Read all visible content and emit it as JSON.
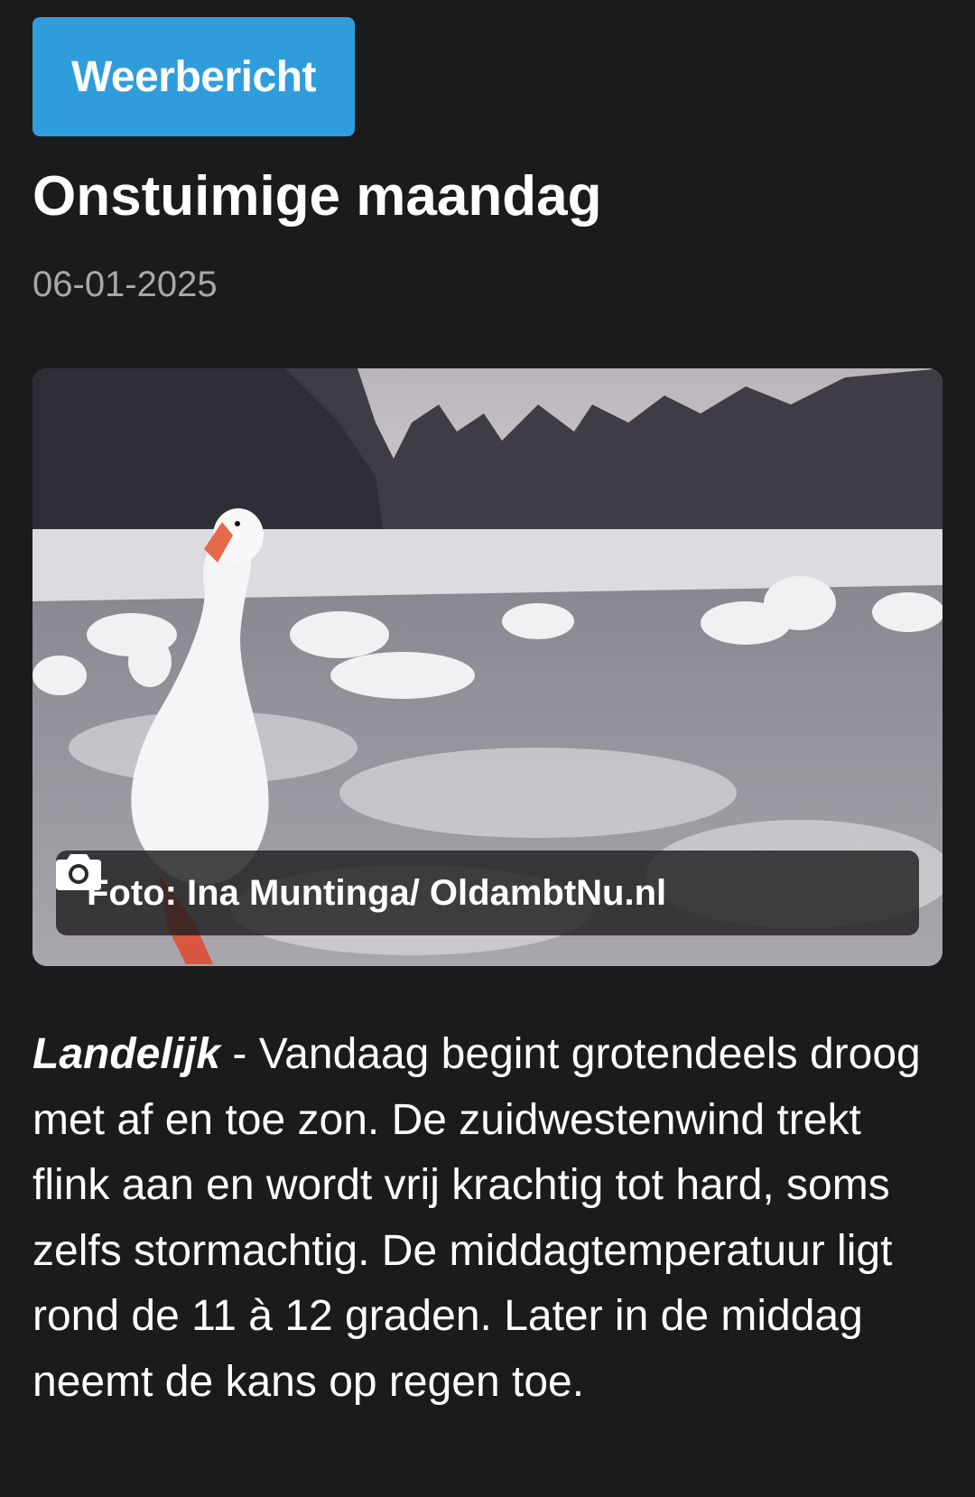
{
  "article": {
    "category": "Weerbericht",
    "title": "Onstuimige maandag",
    "date": "06-01-2025",
    "photo": {
      "caption": "Foto: Ina Muntinga/ OldambtNu.nl",
      "caption_icon": "camera-icon"
    },
    "location": "Landelijk",
    "separator": " - ",
    "body": "Vandaag begint grotendeels droog met af en toe zon. De zuidwestenwind trekt flink aan en wordt vrij krachtig tot hard, soms zelfs stormachtig. De middagtemperatuur ligt rond de 11 à 12 graden. Later in de middag neemt de kans op regen toe."
  },
  "colors": {
    "background": "#1b1b1c",
    "tag": "#2f9ddc",
    "date": "#a8a8a8"
  }
}
